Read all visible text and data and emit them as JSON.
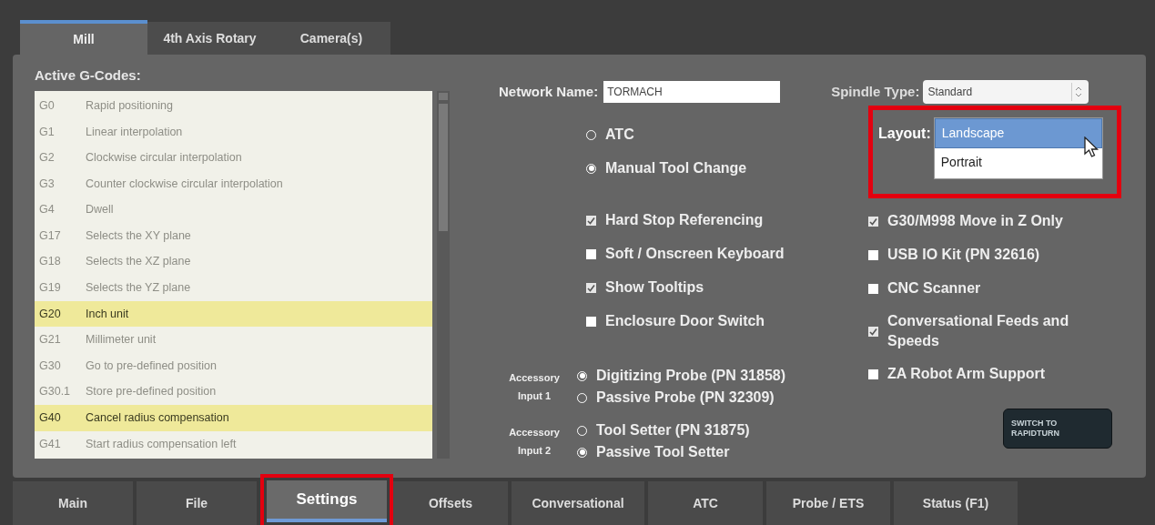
{
  "top_tabs": [
    {
      "label": "Mill",
      "selected": true
    },
    {
      "label": "4th Axis Rotary",
      "selected": false
    },
    {
      "label": "Camera(s)",
      "selected": false
    }
  ],
  "gcodes": {
    "title": "Active G-Codes:",
    "rows": [
      {
        "code": "G0",
        "description": "Rapid positioning",
        "active": false
      },
      {
        "code": "G1",
        "description": "Linear interpolation",
        "active": false
      },
      {
        "code": "G2",
        "description": "Clockwise circular interpolation",
        "active": false
      },
      {
        "code": "G3",
        "description": "Counter clockwise circular interpolation",
        "active": false
      },
      {
        "code": "G4",
        "description": "Dwell",
        "active": false
      },
      {
        "code": "G17",
        "description": "Selects the XY plane",
        "active": false
      },
      {
        "code": "G18",
        "description": "Selects the XZ plane",
        "active": false
      },
      {
        "code": "G19",
        "description": "Selects the YZ plane",
        "active": false
      },
      {
        "code": "G20",
        "description": "Inch unit",
        "active": true
      },
      {
        "code": "G21",
        "description": "Millimeter unit",
        "active": false
      },
      {
        "code": "G30",
        "description": "Go to pre-defined position",
        "active": false
      },
      {
        "code": "G30.1",
        "description": "Store pre-defined position",
        "active": false
      },
      {
        "code": "G40",
        "description": "Cancel radius compensation",
        "active": true
      },
      {
        "code": "G41",
        "description": "Start radius compensation left",
        "active": false
      }
    ]
  },
  "network_name": {
    "label": "Network Name:",
    "value": "TORMACH"
  },
  "spindle_type": {
    "label": "Spindle Type:",
    "value": "Standard"
  },
  "layout": {
    "label": "Layout:",
    "annotated": true,
    "options": [
      {
        "label": "Landscape",
        "selected": true
      },
      {
        "label": "Portrait",
        "selected": false
      }
    ]
  },
  "tool_change": [
    {
      "label": "ATC",
      "selected": false
    },
    {
      "label": "Manual Tool Change",
      "selected": true
    }
  ],
  "options_left": [
    {
      "label": "Hard Stop Referencing",
      "checked": true
    },
    {
      "label": "Soft / Onscreen Keyboard",
      "checked": false
    },
    {
      "label": "Show Tooltips",
      "checked": true
    },
    {
      "label": "Enclosure Door Switch",
      "checked": false
    }
  ],
  "options_right": [
    {
      "label": "G30/M998 Move in Z Only",
      "checked": true
    },
    {
      "label": "USB IO Kit (PN 32616)",
      "checked": false
    },
    {
      "label": "CNC Scanner",
      "checked": false
    },
    {
      "label": "Conversational Feeds and Speeds",
      "checked": true
    },
    {
      "label": "ZA Robot Arm Support",
      "checked": false
    }
  ],
  "accessory_inputs": [
    {
      "label": "Accessory Input 1",
      "options": [
        {
          "label": "Digitizing Probe (PN 31858)",
          "selected": true
        },
        {
          "label": "Passive Probe (PN 32309)",
          "selected": false
        }
      ]
    },
    {
      "label": "Accessory Input 2",
      "options": [
        {
          "label": "Tool Setter (PN 31875)",
          "selected": false
        },
        {
          "label": "Passive Tool Setter",
          "selected": true
        }
      ]
    }
  ],
  "switch_button": {
    "label": "SWITCH TO RAPIDTURN"
  },
  "bottom_tabs": [
    {
      "label": "Main",
      "selected": false,
      "annotated": false
    },
    {
      "label": "File",
      "selected": false,
      "annotated": false
    },
    {
      "label": "Settings",
      "selected": true,
      "annotated": true
    },
    {
      "label": "Offsets",
      "selected": false,
      "annotated": false
    },
    {
      "label": "Conversational",
      "selected": false,
      "annotated": false
    },
    {
      "label": "ATC",
      "selected": false,
      "annotated": false
    },
    {
      "label": "Probe / ETS",
      "selected": false,
      "annotated": false
    },
    {
      "label": "Status (F1)",
      "selected": false,
      "annotated": false
    }
  ]
}
